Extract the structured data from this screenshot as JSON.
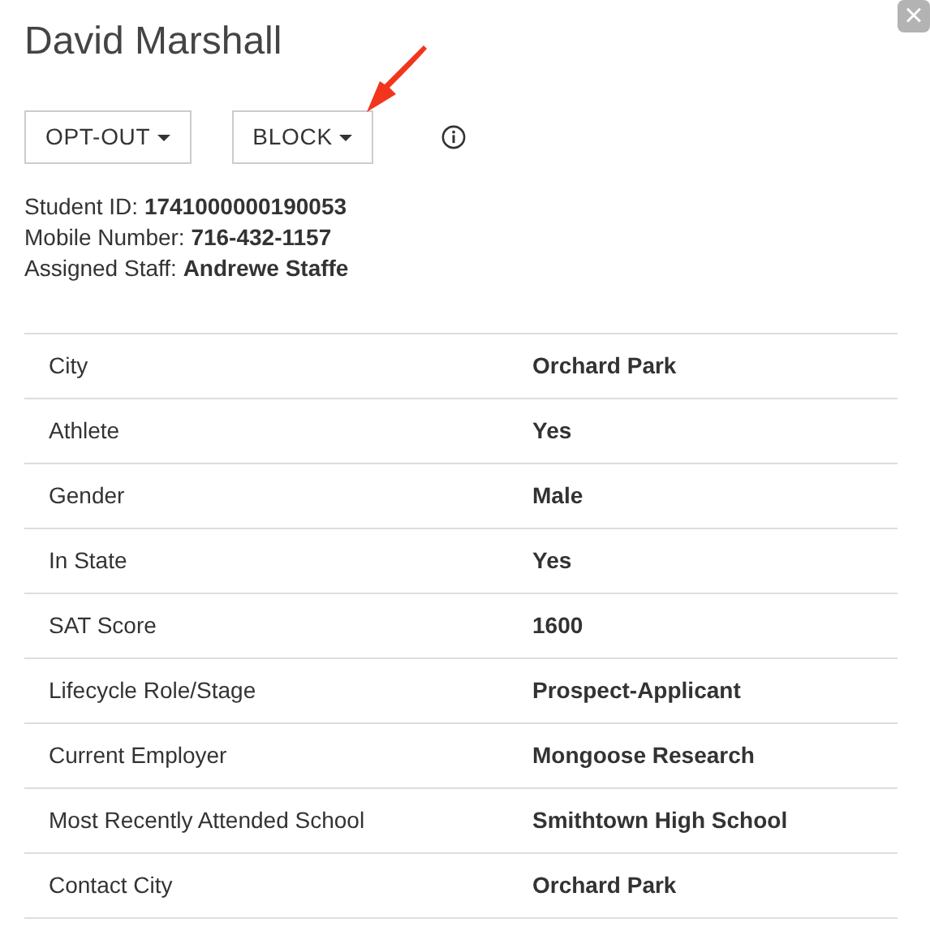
{
  "title": "David Marshall",
  "close_button": {
    "label": "×"
  },
  "actions": [
    {
      "label": "OPT-OUT"
    },
    {
      "label": "BLOCK"
    }
  ],
  "annotation": {
    "kind": "arrow"
  },
  "summary": [
    "Student ID: **1741000000190053**",
    "Mobile Number: **716-432-1157**",
    "Assigned Staff: **Andrewe Staffe**"
  ],
  "table": {
    "rows": [
      {
        "label": "City",
        "value": "Orchard Park"
      },
      {
        "label": "Athlete",
        "value": "Yes"
      },
      {
        "label": "Gender",
        "value": "Male"
      },
      {
        "label": "In State",
        "value": "Yes"
      },
      {
        "label": "SAT Score",
        "value": "1600"
      },
      {
        "label": "Lifecycle Role/Stage",
        "value": "Prospect-Applicant"
      },
      {
        "label": "Current Employer",
        "value": "Mongoose Research"
      },
      {
        "label": "Most Recently Attended School",
        "value": "Smithtown High School"
      },
      {
        "label": "Contact City",
        "value": "Orchard Park"
      }
    ]
  }
}
